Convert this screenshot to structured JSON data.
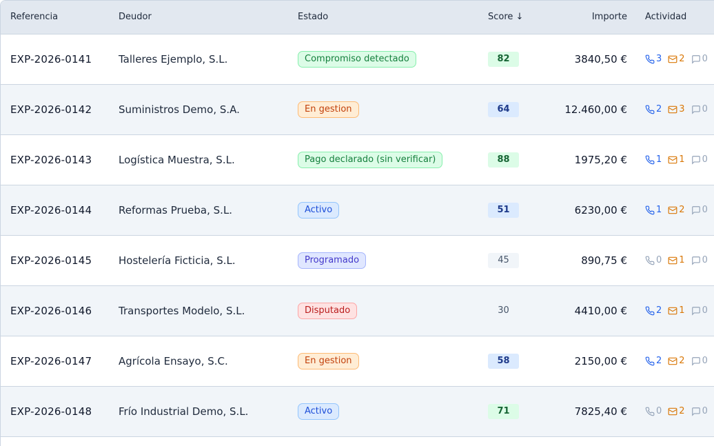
{
  "columns": {
    "referencia": "Referencia",
    "deudor": "Deudor",
    "estado": "Estado",
    "score": "Score ↓",
    "importe": "Importe",
    "actividad": "Actividad"
  },
  "rows": [
    {
      "ref": "EXP-2026-0141",
      "deudor": "Talleres Ejemplo, S.L.",
      "estado": "Compromiso detectado",
      "estado_tone": "green",
      "score": "82",
      "score_tone": "green",
      "importe": "3840,50 €",
      "calls": "3",
      "calls_active": true,
      "mails": "2",
      "mails_active": true,
      "msgs": "0",
      "msgs_active": false
    },
    {
      "ref": "EXP-2026-0142",
      "deudor": "Suministros Demo, S.A.",
      "estado": "En gestion",
      "estado_tone": "orange",
      "score": "64",
      "score_tone": "blue",
      "importe": "12.460,00 €",
      "calls": "2",
      "calls_active": true,
      "mails": "3",
      "mails_active": true,
      "msgs": "0",
      "msgs_active": false
    },
    {
      "ref": "EXP-2026-0143",
      "deudor": "Logística Muestra, S.L.",
      "estado": "Pago declarado (sin verificar)",
      "estado_tone": "green",
      "score": "88",
      "score_tone": "green",
      "importe": "1975,20 €",
      "calls": "1",
      "calls_active": true,
      "mails": "1",
      "mails_active": true,
      "msgs": "0",
      "msgs_active": false
    },
    {
      "ref": "EXP-2026-0144",
      "deudor": "Reformas Prueba, S.L.",
      "estado": "Activo",
      "estado_tone": "blue",
      "score": "51",
      "score_tone": "blue",
      "importe": "6230,00 €",
      "calls": "1",
      "calls_active": true,
      "mails": "2",
      "mails_active": true,
      "msgs": "0",
      "msgs_active": false
    },
    {
      "ref": "EXP-2026-0145",
      "deudor": "Hostelería Ficticia, S.L.",
      "estado": "Programado",
      "estado_tone": "indigo",
      "score": "45",
      "score_tone": "gray",
      "importe": "890,75 €",
      "calls": "0",
      "calls_active": false,
      "mails": "1",
      "mails_active": true,
      "msgs": "0",
      "msgs_active": false
    },
    {
      "ref": "EXP-2026-0146",
      "deudor": "Transportes Modelo, S.L.",
      "estado": "Disputado",
      "estado_tone": "red",
      "score": "30",
      "score_tone": "none",
      "importe": "4410,00 €",
      "calls": "2",
      "calls_active": true,
      "mails": "1",
      "mails_active": true,
      "msgs": "0",
      "msgs_active": false
    },
    {
      "ref": "EXP-2026-0147",
      "deudor": "Agrícola Ensayo, S.C.",
      "estado": "En gestion",
      "estado_tone": "orange",
      "score": "58",
      "score_tone": "blue",
      "importe": "2150,00 €",
      "calls": "2",
      "calls_active": true,
      "mails": "2",
      "mails_active": true,
      "msgs": "0",
      "msgs_active": false
    },
    {
      "ref": "EXP-2026-0148",
      "deudor": "Frío Industrial Demo, S.L.",
      "estado": "Activo",
      "estado_tone": "blue",
      "score": "71",
      "score_tone": "green",
      "importe": "7825,40 €",
      "calls": "0",
      "calls_active": false,
      "mails": "2",
      "mails_active": true,
      "msgs": "0",
      "msgs_active": false
    }
  ],
  "icons": {
    "calls": "phone-icon",
    "mails": "mail-icon",
    "msgs": "message-icon"
  },
  "colors": {
    "active_blue": "#2563eb",
    "active_orange": "#d97706",
    "inactive": "#94a3b8"
  }
}
